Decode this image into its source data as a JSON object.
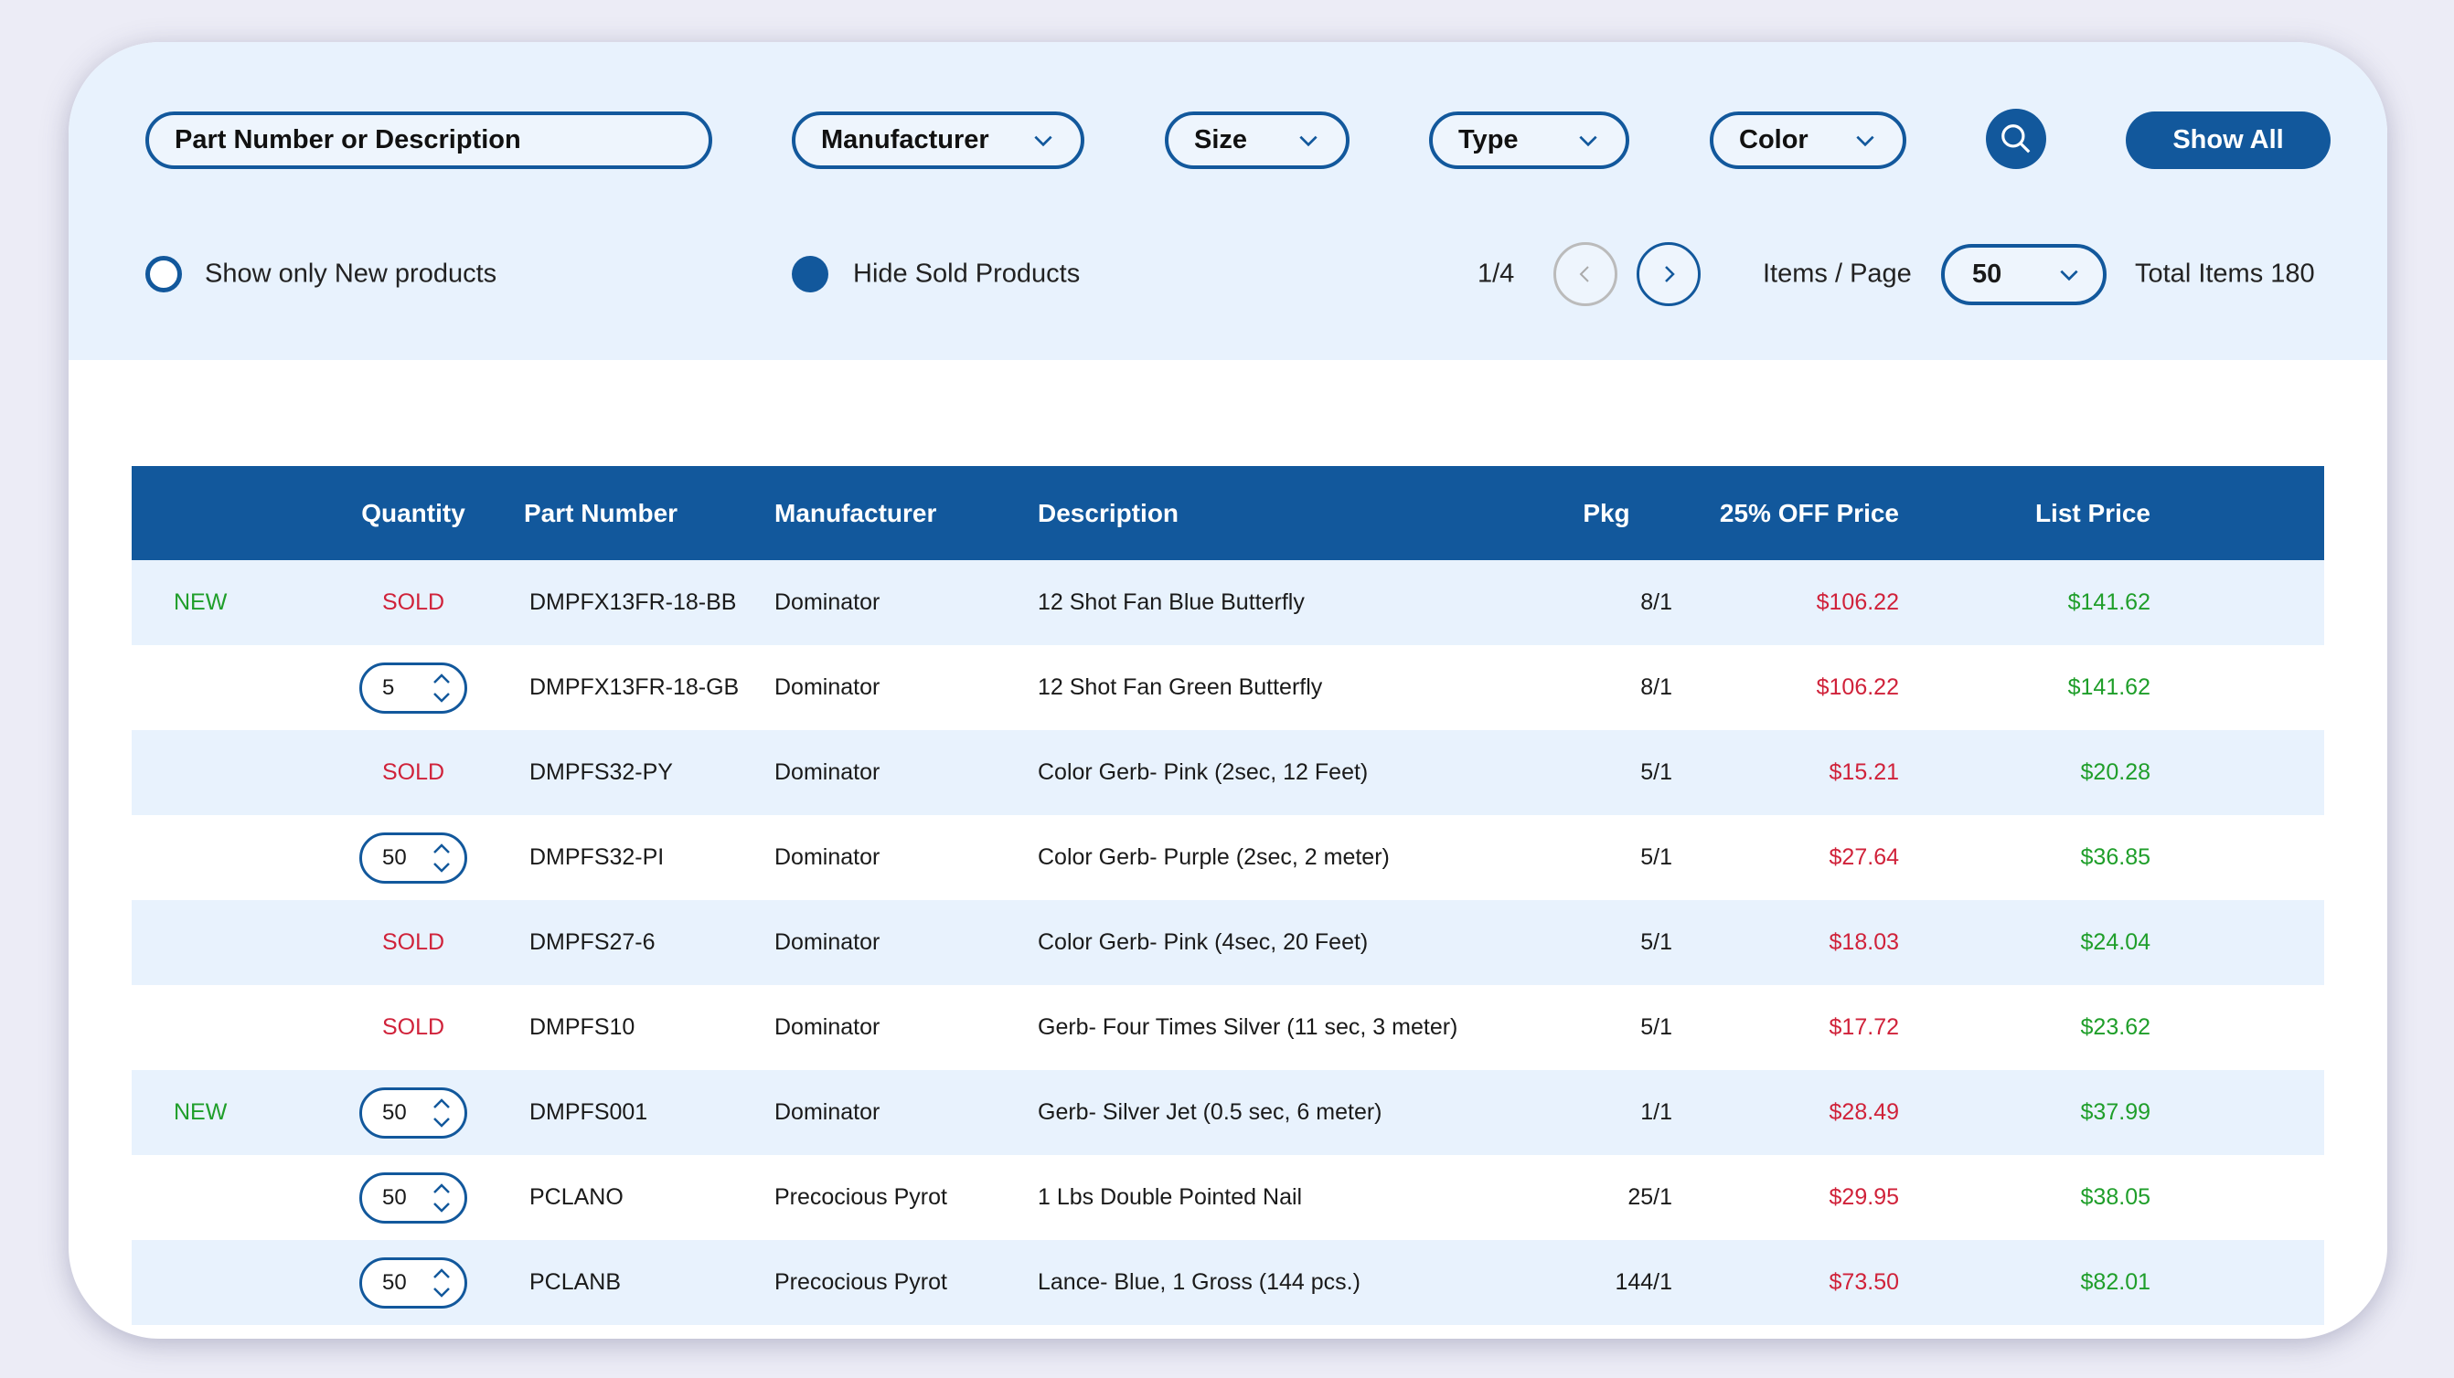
{
  "filters": {
    "search_placeholder": "Part Number or Description",
    "manufacturer": "Manufacturer",
    "size": "Size",
    "type": "Type",
    "color": "Color",
    "show_all": "Show All"
  },
  "options": {
    "show_new": "Show only New products",
    "show_new_checked": false,
    "hide_sold": "Hide Sold Products",
    "hide_sold_checked": true
  },
  "pagination": {
    "page": "1/4",
    "items_per_page_label": "Items / Page",
    "items_per_page": "50",
    "total": "Total Items 180"
  },
  "table": {
    "headers": [
      "",
      "Quantity",
      "Part Number",
      "Manufacturer",
      "Description",
      "Pkg",
      "25% OFF Price",
      "List Price"
    ],
    "rows": [
      {
        "badge": "NEW",
        "qty": "SOLD",
        "part": "DMPFX13FR-18-BB",
        "mfr": "Dominator",
        "desc": "12 Shot Fan Blue Butterfly",
        "pkg": "8/1",
        "sale": "$106.22",
        "list": "$141.62"
      },
      {
        "badge": "",
        "qty": "5",
        "part": "DMPFX13FR-18-GB",
        "mfr": "Dominator",
        "desc": "12 Shot Fan Green Butterfly",
        "pkg": "8/1",
        "sale": "$106.22",
        "list": "$141.62"
      },
      {
        "badge": "",
        "qty": "SOLD",
        "part": "DMPFS32-PY",
        "mfr": "Dominator",
        "desc": "Color Gerb- Pink (2sec, 12 Feet)",
        "pkg": "5/1",
        "sale": "$15.21",
        "list": "$20.28"
      },
      {
        "badge": "",
        "qty": "50",
        "part": "DMPFS32-PI",
        "mfr": "Dominator",
        "desc": "Color Gerb- Purple (2sec, 2 meter)",
        "pkg": "5/1",
        "sale": "$27.64",
        "list": "$36.85"
      },
      {
        "badge": "",
        "qty": "SOLD",
        "part": "DMPFS27-6",
        "mfr": "Dominator",
        "desc": "Color Gerb- Pink (4sec, 20 Feet)",
        "pkg": "5/1",
        "sale": "$18.03",
        "list": "$24.04"
      },
      {
        "badge": "",
        "qty": "SOLD",
        "part": "DMPFS10",
        "mfr": "Dominator",
        "desc": "Gerb- Four Times Silver (11 sec, 3 meter)",
        "pkg": "5/1",
        "sale": "$17.72",
        "list": "$23.62"
      },
      {
        "badge": "NEW",
        "qty": "50",
        "part": "DMPFS001",
        "mfr": "Dominator",
        "desc": "Gerb- Silver Jet (0.5 sec, 6 meter)",
        "pkg": "1/1",
        "sale": "$28.49",
        "list": "$37.99"
      },
      {
        "badge": "",
        "qty": "50",
        "part": "PCLANO",
        "mfr": "Precocious Pyrot",
        "desc": "1 Lbs Double Pointed Nail",
        "pkg": "25/1",
        "sale": "$29.95",
        "list": "$38.05"
      },
      {
        "badge": "",
        "qty": "50",
        "part": "PCLANB",
        "mfr": "Precocious Pyrot",
        "desc": "Lance- Blue, 1 Gross (144 pcs.)",
        "pkg": "144/1",
        "sale": "$73.50",
        "list": "$82.01"
      }
    ]
  },
  "colors": {
    "accent": "#12589c",
    "sold": "#d0223a",
    "new": "#1f9e2a",
    "panel": "#e8f2fd"
  }
}
